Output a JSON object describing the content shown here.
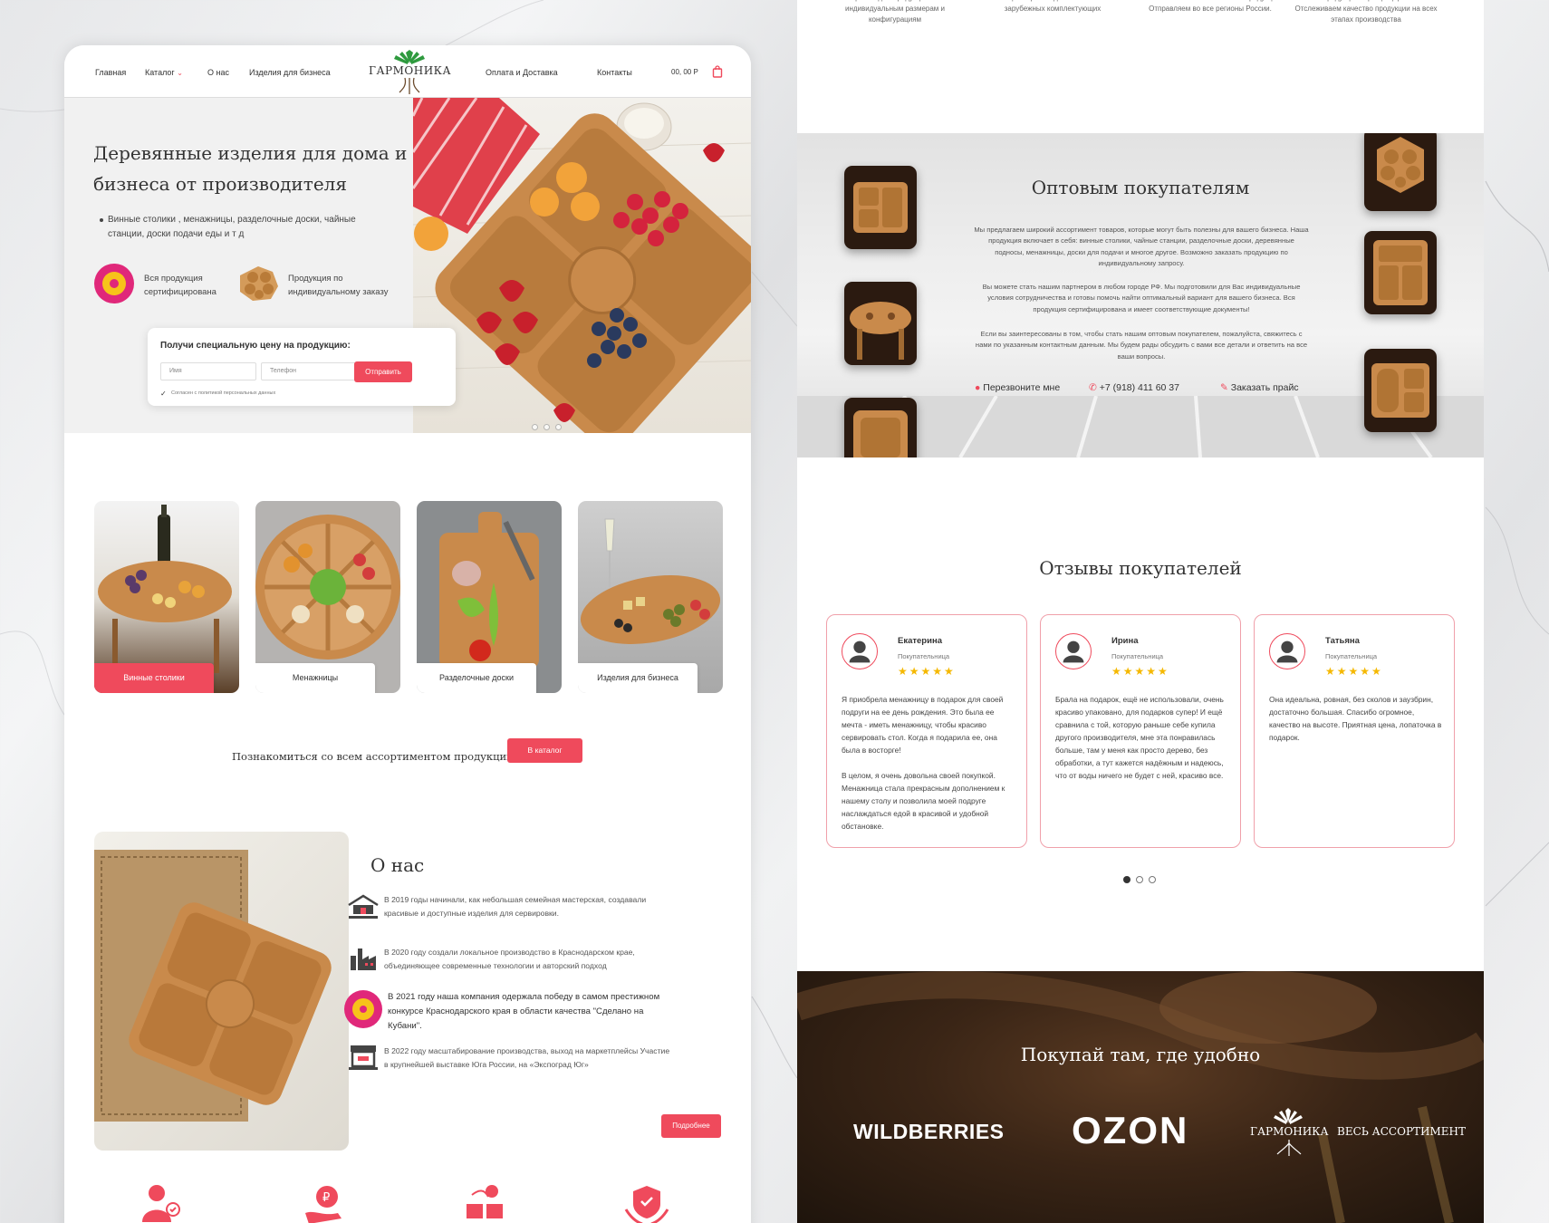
{
  "header": {
    "nav": [
      "Главная",
      "Каталог",
      "О нас",
      "Изделия для бизнеса",
      "Оплата и Доставка",
      "Контакты"
    ],
    "logo_text": "ГАРМОНИКА",
    "cart_total": "00, 00 Р"
  },
  "hero": {
    "title": "Деревянные изделия для дома и бизнеса от производителя",
    "subtitle": "Винные столики , менажницы, разделочные доски, чайные станции, доски подачи еды и т д",
    "badge1": "Вся продукция сертифицирована",
    "badge2": "Продукция по индивидуальному заказу"
  },
  "form": {
    "title": "Получи специальную цену на продукцию:",
    "name_placeholder": "Имя",
    "phone_placeholder": "Телефон",
    "submit": "Отправить",
    "consent": "Согласен с политикой персональных данных"
  },
  "categories": [
    "Винные столики",
    "Менажницы",
    "Разделочные доски",
    "Изделия для бизнеса"
  ],
  "catalog_cta": {
    "text": "Познакомиться со всем ассортиментом продукции",
    "button": "В каталог"
  },
  "about": {
    "title": "О нас",
    "items": [
      "В 2019 годы начинали, как небольшая семейная мастерская, создавали красивые и доступные изделия для сервировки.",
      "В 2020 году создали локальное производство в Краснодарском крае, объединяющее современные технологии и авторский подход",
      "В 2021 году наша компания одержала победу в самом престижном конкурсе Краснодарского края в области качества \"Сделано на Кубани\".",
      "В 2022 году масштабирование производства, выход на маркетплейсы Участие в крупнейшей выставке Юга России, на «Экспоград Юг»"
    ],
    "more": "Подробнее"
  },
  "features": [
    "Производим продукцию по индивидуальным размерам и конфигурациям",
    "Полный цикл производства. Не зависим от зарубежных комплектующих",
    "Работаем с любыми объемами продукции. Отправляем во все регионы России.",
    "Вся продукция сертифицирована. Отслеживаем качество продукции на всех этапах производства"
  ],
  "wholesale": {
    "title": "Оптовым покупателям",
    "p1": "Мы предлагаем широкий ассортимент товаров, которые могут быть полезны для вашего бизнеса. Наша продукция включает в себя: винные столики, чайные станции, разделочные доски, деревянные подносы, менажницы, доски для подачи и многое другое. Возможно заказать продукцию по индивидуальному запросу.",
    "p2": "Вы можете стать нашим партнером в любом городе РФ. Мы подготовили для Вас индивидуальные условия сотрудничества и готовы помочь найти оптимальный вариант для вашего бизнеса. Вся продукция сертифицирована и имеет соответствующие документы!",
    "p3": "Если вы заинтересованы в том, чтобы стать нашим оптовым покупателем, пожалуйста, свяжитесь с нами по указанным контактным данным. Мы будем рады обсудить с вами все детали и ответить на все ваши вопросы.",
    "callback": "Перезвоните мне",
    "phone": "+7 (918) 411 60 37",
    "price": "Заказать прайс"
  },
  "reviews": {
    "title": "Отзывы покупателей",
    "role": "Покупательница",
    "stars": "★★★★★",
    "items": [
      {
        "name": "Екатерина",
        "text": "Я приобрела менажницу в подарок для своей подруги на ее день рождения. Это была ее мечта - иметь менажницу, чтобы красиво сервировать стол. Когда я подарила ее, она была в восторге!\n\nВ целом, я очень довольна своей покупкой. Менажница стала прекрасным дополнением к нашему столу и позволила моей подруге наслаждаться едой в красивой и удобной обстановке."
      },
      {
        "name": "Ирина",
        "text": "Брала на подарок, ещё не использовали, очень красиво упаковано, для подарков супер! И ещё сравнила с той, которую раньше себе купила другого производителя, мне эта понравилась больше, там у меня как просто дерево, без обработки, а тут кажется надёжным и надеюсь, что от воды ничего не будет с ней, красиво все."
      },
      {
        "name": "Татьяна",
        "text": "Она идеальна, ровная, без сколов и заузбрин, достаточно большая. Спасибо огромное, качество на высоте. Приятная цена, лопаточка в подарок."
      }
    ]
  },
  "marketplaces": {
    "title": "Покупай там, где удобно",
    "wb": "WILDBERRIES",
    "ozon": "OZON",
    "brand": "ГАРМОНИКА",
    "all": "ВЕСЬ АССОРТИМЕНТ"
  },
  "colors": {
    "accent": "#ef4a5c",
    "wood": "#c98a4b",
    "star": "#f5b800"
  }
}
